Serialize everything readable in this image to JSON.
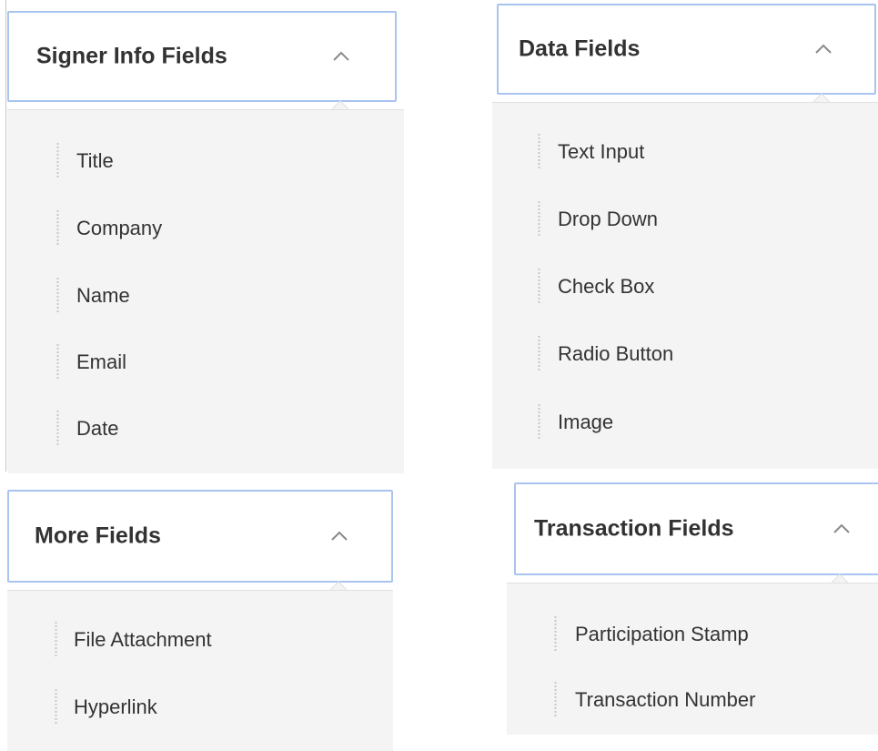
{
  "panels": {
    "signer_info": {
      "title": "Signer Info Fields",
      "items": [
        "Title",
        "Company",
        "Name",
        "Email",
        "Date"
      ]
    },
    "data_fields": {
      "title": "Data Fields",
      "items": [
        "Text Input",
        "Drop Down",
        "Check Box",
        "Radio Button",
        "Image"
      ]
    },
    "more_fields": {
      "title": "More Fields",
      "items": [
        "File Attachment",
        "Hyperlink"
      ]
    },
    "transaction_fields": {
      "title": "Transaction Fields",
      "items": [
        "Participation Stamp",
        "Transaction Number"
      ]
    }
  },
  "colors": {
    "header_border": "#a9c4f0",
    "body_background": "#f4f4f4",
    "chevron": "#8a8a8a",
    "drag_handle": "#c7c7c7"
  },
  "icons": {
    "collapse": "chevron-up-icon",
    "drag": "drag-handle-icon"
  }
}
